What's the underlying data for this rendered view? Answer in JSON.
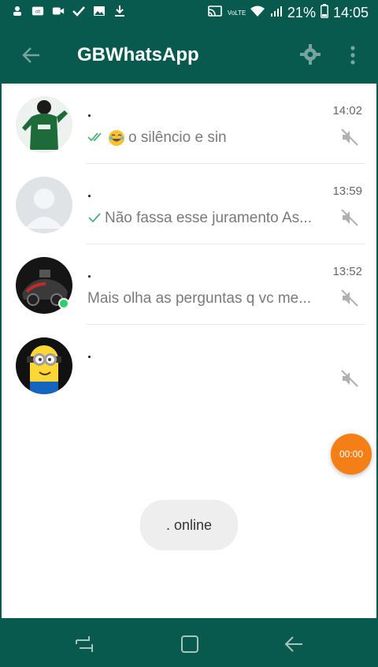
{
  "status_bar": {
    "network": "VoLTE",
    "battery_percent": "21%",
    "time": "14:05"
  },
  "app_bar": {
    "title": "GBWhatsApp"
  },
  "chats": [
    {
      "name": ".",
      "time": "14:02",
      "preview": "o silêncio e sin",
      "ticks": "double",
      "emoji": "joy",
      "muted": true,
      "online": false,
      "avatar": "photo-player"
    },
    {
      "name": ".",
      "time": "13:59",
      "preview": "Não fassa esse juramento As...",
      "ticks": "single",
      "emoji": "",
      "muted": true,
      "online": false,
      "avatar": "default-profile"
    },
    {
      "name": ".",
      "time": "13:52",
      "preview": "Mais olha as perguntas q vc me...",
      "ticks": "",
      "emoji": "",
      "muted": true,
      "online": true,
      "avatar": "photo-car"
    },
    {
      "name": ".",
      "time": "",
      "preview": "",
      "ticks": "",
      "emoji": "",
      "muted": true,
      "online": false,
      "avatar": "photo-minion"
    }
  ],
  "recording_timer": "00:00",
  "toast": ". online",
  "colors": {
    "primary": "#085a4f",
    "online": "#25d366",
    "timer": "#f57f17"
  }
}
